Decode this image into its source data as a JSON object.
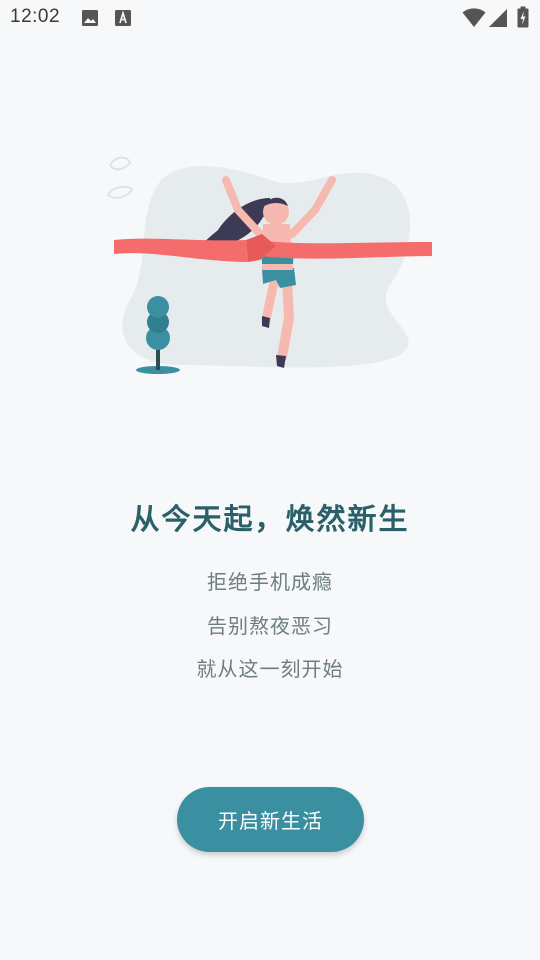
{
  "status_bar": {
    "time": "12:02",
    "icons": [
      "image-icon",
      "text-a-icon",
      "wifi-icon",
      "signal-icon",
      "battery-charging-icon"
    ]
  },
  "illustration": {
    "name": "runner-finish-line-illustration",
    "colors": {
      "blob": "#e6eced",
      "ribbon": "#f46c6c",
      "teal": "#3a8fa0",
      "hair": "#3c3a55",
      "skin": "#f6b9b0"
    }
  },
  "intro": {
    "headline": "从今天起，焕然新生",
    "lines": [
      "拒绝手机成瘾",
      "告别熬夜恶习",
      "就从这一刻开始"
    ]
  },
  "cta": {
    "label": "开启新生活"
  },
  "colors": {
    "background": "#f6f8fa",
    "accent": "#3a8fa0",
    "headline": "#2c6068",
    "subtext": "#6e7c84"
  }
}
